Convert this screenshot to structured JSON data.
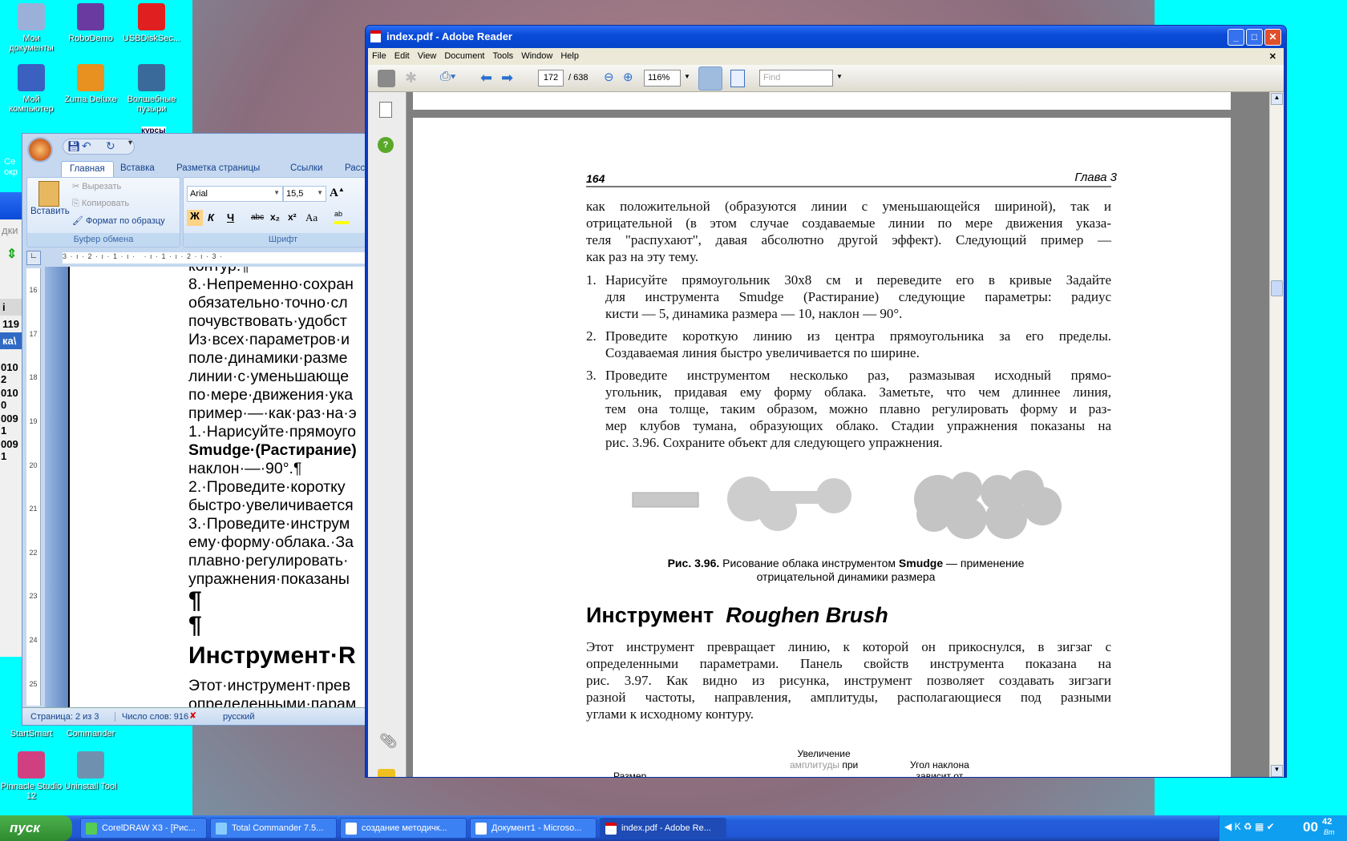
{
  "desktop": {
    "icons": [
      {
        "label": "Мои документы",
        "color": "#9ab0d8"
      },
      {
        "label": "RoboDemo",
        "color": "#6a3aa0"
      },
      {
        "label": "USBDiskSec...",
        "color": "#e02020"
      },
      {
        "label": "Мой компьютер",
        "color": "#3a60c0"
      },
      {
        "label": "Zuma Deluxe",
        "color": "#e89020"
      },
      {
        "label": "Волшебные пузыри",
        "color": "#3a6a9a"
      },
      {
        "label": "StartSmart",
        "color": "#e03030"
      },
      {
        "label": "Commander",
        "color": "#e09020"
      },
      {
        "label": "Pinnacle Studio 12",
        "color": "#d04080"
      },
      {
        "label": "Uninstall Tool",
        "color": "#7090b0"
      }
    ],
    "partial_labels": [
      "курсы",
      "Се",
      "окр"
    ]
  },
  "total_commander": {
    "fragments": [
      "дки",
      "i",
      "119",
      "ка\\",
      "010 2",
      "010 0",
      "009 1",
      "009 1"
    ]
  },
  "word": {
    "tabs": [
      "Главная",
      "Вставка",
      "Разметка страницы",
      "Ссылки",
      "Расс"
    ],
    "clipboard": {
      "paste": "Вставить",
      "cut": "Вырезать",
      "copy": "Копировать",
      "format_painter": "Формат по образцу",
      "group": "Буфер обмена"
    },
    "font": {
      "name": "Arial",
      "size": "15,5",
      "group": "Шрифт",
      "bold": "Ж",
      "italic": "К",
      "underline": "Ч",
      "strike": "abc",
      "sub": "x₂",
      "sup": "x²",
      "case": "Aa"
    },
    "ruler_top": "3 · ı · 2 · ı · 1 · ı ·   · ı · 1 · ı · 2 · ı · 3 ·",
    "ruler_left": [
      "16",
      "17",
      "18",
      "19",
      "20",
      "21",
      "22",
      "23",
      "24",
      "25"
    ],
    "lines": [
      "контур.¶",
      "8.·Непременно·сохран",
      "обязательно·точно·сл",
      "почувствовать·удобст",
      "Из·всех·параметров·и",
      "поле·динамики·разме",
      "линии·с·уменьшающе",
      "по·мере·движения·ука",
      "пример·—·как·раз·на·э",
      "1.·Нарисуйте·прямоуго",
      "Smudge·(Растирание)",
      "наклон·—·90°.¶",
      "2.·Проведите·коротку",
      "быстро·увеличивается",
      "3.·Проведите·инструм",
      "ему·форму·облака.·За",
      "плавно·регулировать·",
      "упражнения·показаны",
      "¶",
      "¶",
      "Инструмент·R",
      "Этот·инструмент·прев",
      "определенными·парам"
    ],
    "status": {
      "page": "Страница: 2 из 3",
      "words": "Число слов: 916",
      "lang": "русский"
    }
  },
  "pdf": {
    "title": "index.pdf - Adobe Reader",
    "menu": [
      "File",
      "Edit",
      "View",
      "Document",
      "Tools",
      "Window",
      "Help"
    ],
    "page_current": "172",
    "page_total": "/ 638",
    "zoom": "116%",
    "find_placeholder": "Find",
    "page": {
      "number": "164",
      "chapter": "Глава 3",
      "intro": [
        "как положительной (образуются линии с уменьшающейся шириной), так и",
        "отрицательной (в этом случае создаваемые линии по мере движения указа-",
        "теля \"распухают\", давая абсолютно другой эффект). Следующий пример —",
        "как раз на эту тему."
      ],
      "items": [
        {
          "num": "1.",
          "lines": [
            "Нарисуйте прямоугольник 30x8 см и переведите его в кривые Задайте",
            "для инструмента  Smudge (Растирание) следующие параметры: радиус",
            "кисти — 5, динамика размера — 10, наклон — 90°."
          ]
        },
        {
          "num": "2.",
          "lines": [
            "Проведите короткую линию из центра прямоугольника за его пределы.",
            "Создаваемая линия быстро увеличивается по ширине."
          ]
        },
        {
          "num": "3.",
          "lines": [
            "Проведите инструментом несколько раз, размазывая исходный прямо-",
            "угольник, придавая ему форму облака. Заметьте, что чем длиннее линия,",
            "тем она толще, таким образом, можно плавно регулировать форму и раз-",
            "мер клубов тумана, образующих облако. Стадии упражнения показаны на",
            "рис. 3.96. Сохраните объект для следующего упражнения."
          ]
        }
      ],
      "caption_label": "Рис. 3.96.",
      "caption_text": "Рисование облака инструментом",
      "caption_bold": "Smudge",
      "caption_rest": "— применение",
      "caption_line2": "отрицательной динамики размера",
      "heading": "Инструмент",
      "heading_italic": "Roughen Brush",
      "para": [
        "Этот инструмент превращает линию, к которой он прикоснулся, в зигзаг с",
        "определенными параметрами. Панель свойств инструмента показана на",
        "рис. 3.97. Как видно из рисунка, инструмент позволяет создавать зигзаги",
        "разной частоты, направления, амплитуды, располагающиеся под разными",
        "углами к исходному контуру."
      ],
      "diagram_labels": [
        "Увеличение",
        "амплитуды",
        "при",
        "Угол наклона",
        "зависит от",
        "Размер"
      ]
    }
  },
  "taskbar": {
    "start": "пуск",
    "tasks": [
      "CorelDRAW X3 - [Рис...",
      "Total Commander 7.5...",
      "создание методичк...",
      "Документ1 - Microso...",
      "index.pdf - Adobe Re..."
    ],
    "clock": "00",
    "clock_small": "42",
    "clock_day": "Вт"
  }
}
